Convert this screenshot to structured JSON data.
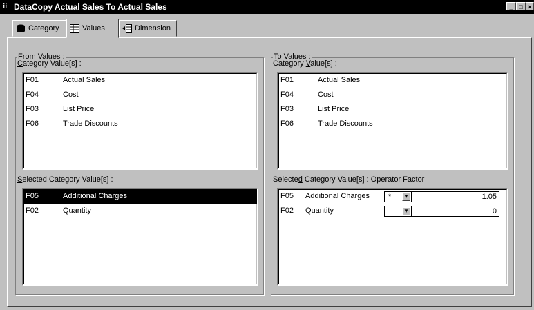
{
  "window": {
    "title": "DataCopy Actual Sales To Actual Sales"
  },
  "tabs": [
    {
      "label": "Category",
      "icon": "database-icon"
    },
    {
      "label": "Values",
      "icon": "table-icon"
    },
    {
      "label": "Dimension",
      "icon": "dimension-icon"
    }
  ],
  "from": {
    "group_label": "From Values :",
    "list_label": "Category Value[s] :",
    "items": [
      {
        "code": "F01",
        "desc": "Actual Sales"
      },
      {
        "code": "F04",
        "desc": "Cost"
      },
      {
        "code": "F03",
        "desc": "List Price"
      },
      {
        "code": "F06",
        "desc": "Trade Discounts"
      }
    ],
    "selected_label": "Selected Category Value[s] :",
    "selected_items": [
      {
        "code": "F05",
        "desc": "Additional Charges"
      },
      {
        "code": "F02",
        "desc": "Quantity"
      }
    ]
  },
  "to": {
    "group_label": "To Values :",
    "list_label": "Category Value[s] :",
    "items": [
      {
        "code": "F01",
        "desc": "Actual Sales"
      },
      {
        "code": "F04",
        "desc": "Cost"
      },
      {
        "code": "F03",
        "desc": "List Price"
      },
      {
        "code": "F06",
        "desc": "Trade Discounts"
      }
    ],
    "selected_label": "Selected Category Value[s] :",
    "operator_label": "Operator",
    "factor_label": "Factor",
    "selected_items": [
      {
        "code": "F05",
        "desc": "Additional Charges",
        "operator": "*",
        "factor": "1.05"
      },
      {
        "code": "F02",
        "desc": "Quantity",
        "operator": "",
        "factor": "0"
      }
    ]
  }
}
